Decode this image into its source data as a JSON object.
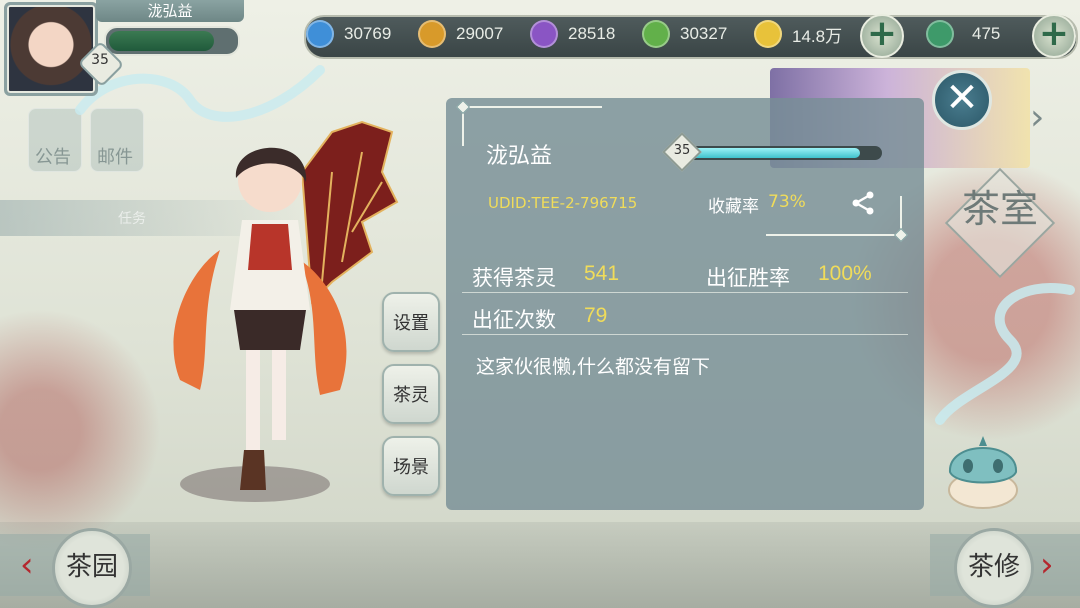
{
  "player": {
    "name": "泷弘益",
    "level": "35",
    "udid": "UDID:TEE-2-796715",
    "favorite_rate_label": "收藏率",
    "favorite_rate": "73%",
    "level_progress": 0.9,
    "exp_progress": 0.85,
    "signature": "这家伙很懒,什么都没有留下"
  },
  "stats": {
    "spirits_label": "获得茶灵",
    "spirits_value": "541",
    "win_rate_label": "出征胜率",
    "win_rate_value": "100%",
    "expedition_label": "出征次数",
    "expedition_value": "79"
  },
  "currencies": [
    {
      "icon": "blue-orb-icon",
      "color": "#3f8fd8",
      "value": "30769"
    },
    {
      "icon": "gold-orb-icon",
      "color": "#d89a2a",
      "value": "29007"
    },
    {
      "icon": "purple-orb-icon",
      "color": "#8a55c4",
      "value": "28518"
    },
    {
      "icon": "green-orb-icon",
      "color": "#62b04a",
      "value": "30327"
    },
    {
      "icon": "coin-icon",
      "color": "#e8c23a",
      "value": "14.8万"
    },
    {
      "icon": "jade-icon",
      "color": "#3e9a6a",
      "value": "475"
    }
  ],
  "side_buttons": {
    "settings": "设置",
    "tea_spirit": "茶灵",
    "scene": "场景"
  },
  "bottom_nav": {
    "left": "茶园",
    "right": "茶修"
  },
  "background": {
    "left_btn_1": "公告",
    "left_btn_2": "邮件",
    "strip_text": "任务",
    "side_banner": "茶室"
  }
}
